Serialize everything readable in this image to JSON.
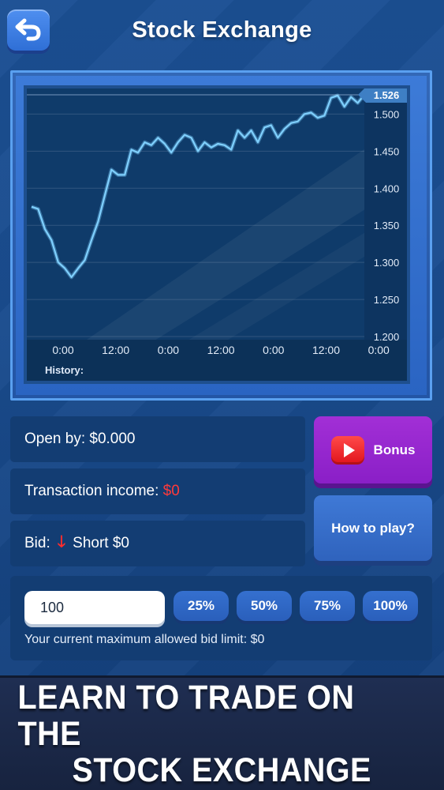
{
  "header": {
    "title": "Stock Exchange",
    "back_icon": "back-arrow-icon"
  },
  "chart_data": {
    "type": "line",
    "title": "",
    "xlabel": "",
    "ylabel": "",
    "x_tick_labels": [
      "0:00",
      "12:00",
      "0:00",
      "12:00",
      "0:00",
      "12:00",
      "0:00"
    ],
    "y_tick_labels": [
      "1.500",
      "1.450",
      "1.400",
      "1.350",
      "1.300",
      "1.250",
      "1.200"
    ],
    "y_ticks": [
      1.5,
      1.45,
      1.4,
      1.35,
      1.3,
      1.25,
      1.2
    ],
    "ylim": [
      1.2,
      1.526
    ],
    "current_value_label": "1.526",
    "current_value": 1.526,
    "grid": true,
    "line_color": "#7fd0ff",
    "series": [
      {
        "values": [
          1.375,
          1.372,
          1.345,
          1.33,
          1.3,
          1.292,
          1.28,
          1.292,
          1.303,
          1.33,
          1.355,
          1.39,
          1.425,
          1.418,
          1.418,
          1.452,
          1.448,
          1.462,
          1.458,
          1.468,
          1.46,
          1.448,
          1.462,
          1.472,
          1.468,
          1.45,
          1.462,
          1.455,
          1.46,
          1.458,
          1.452,
          1.478,
          1.468,
          1.478,
          1.462,
          1.482,
          1.485,
          1.468,
          1.48,
          1.488,
          1.49,
          1.5,
          1.502,
          1.495,
          1.498,
          1.522,
          1.525,
          1.51,
          1.523,
          1.515,
          1.526
        ]
      }
    ],
    "history_label": "History:"
  },
  "info": {
    "open_by_label": "Open by:",
    "open_by_value": "$0.000",
    "income_label": "Transaction income:",
    "income_value": "$0",
    "bid_label": "Bid:",
    "bid_value": "Short $0",
    "bid_direction_icon": "arrow-down-icon"
  },
  "buttons": {
    "bonus_label": "Bonus",
    "bonus_icon": "video-play-icon",
    "howto_label": "How to play?"
  },
  "bid": {
    "amount_value": "100",
    "percent_options": [
      "25%",
      "50%",
      "75%",
      "100%"
    ],
    "limit_text": "Your current maximum allowed bid limit: $0"
  },
  "banner": {
    "line1": "LEARN TO TRADE ON THE",
    "line2": "STOCK EXCHANGE"
  },
  "colors": {
    "accent_red": "#ff3a3a",
    "bonus_purple": "#9a2ad2",
    "button_blue": "#3570cf"
  }
}
